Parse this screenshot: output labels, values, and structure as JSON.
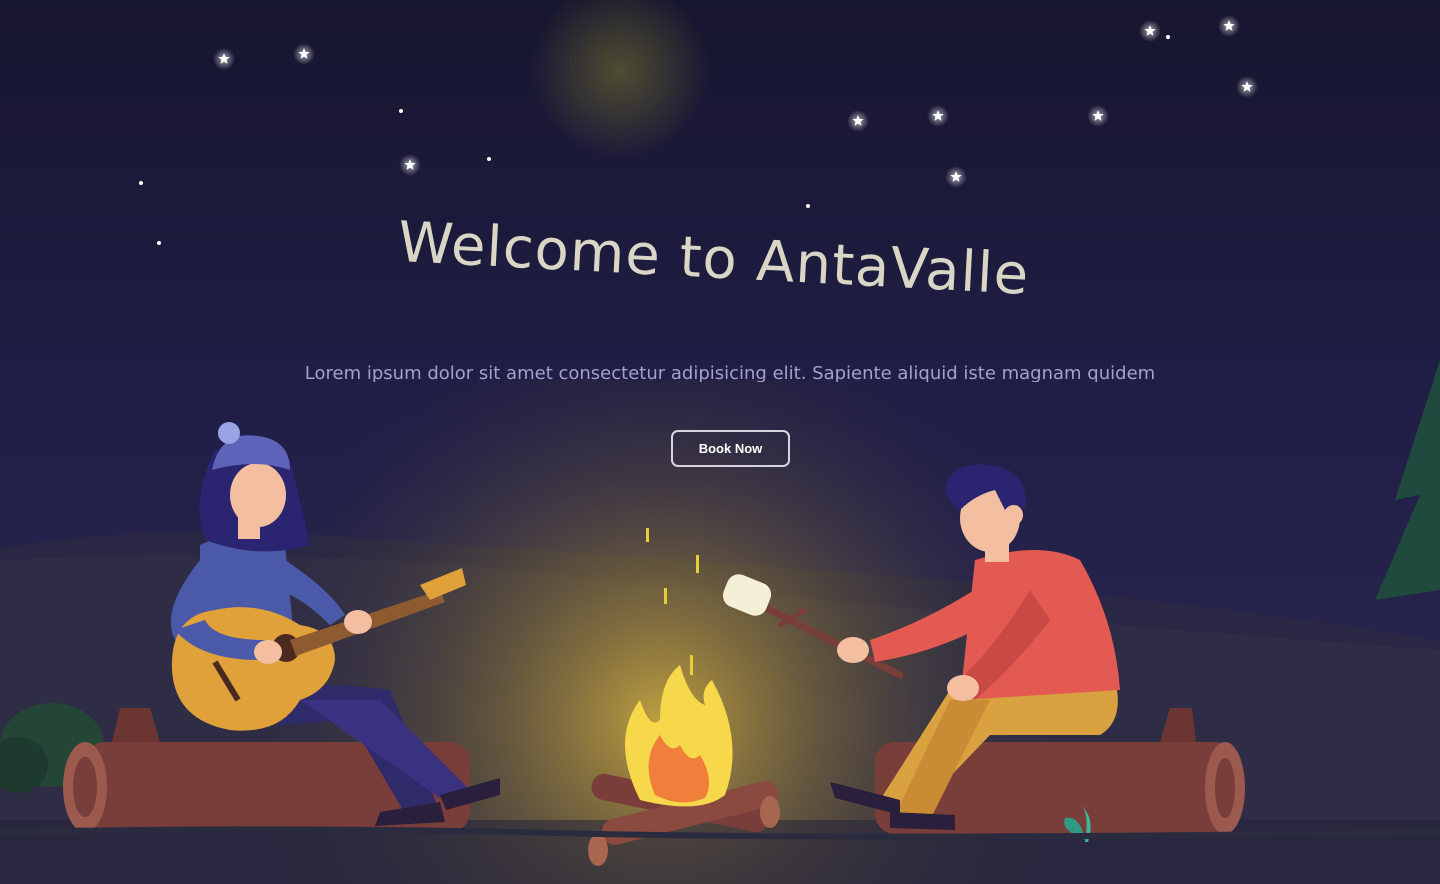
{
  "hero": {
    "title": "Welcome to AntaValle",
    "subtitle": "Lorem ipsum dolor sit amet consectetur adipisicing elit. Sapiente aliquid iste magnam quidem",
    "book_button_label": "Book Now"
  },
  "icons": {
    "moon": "crescent-moon-icon",
    "stars": "star-icon",
    "campfire": "campfire-illustration"
  },
  "colors": {
    "sky": "#1c1a3c",
    "moon": "#f5ee2b",
    "title_text": "#d9d6c6",
    "subtitle_text": "#a4a2c9",
    "button_border": "#d6d4de",
    "fire_glow": "#f6c431"
  }
}
